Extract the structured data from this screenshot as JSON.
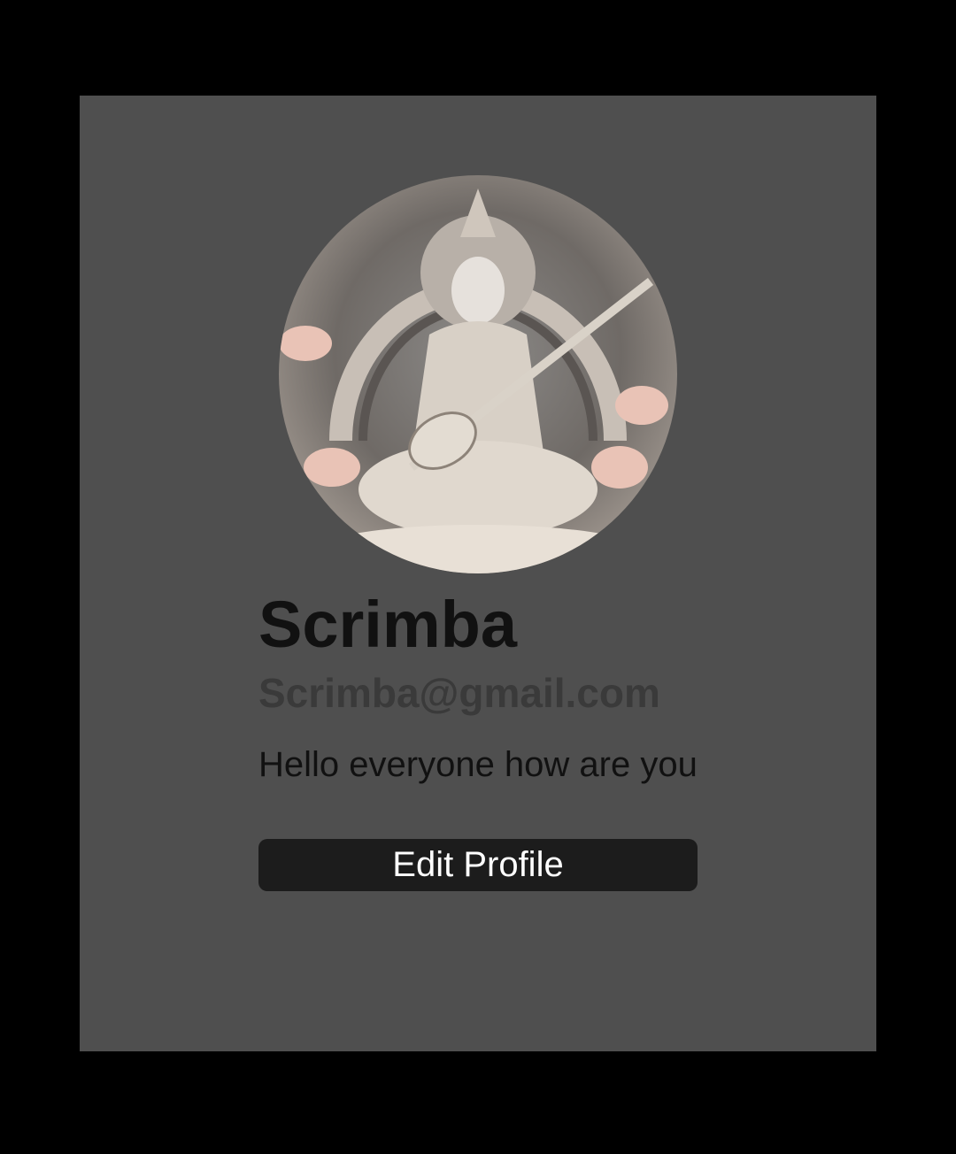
{
  "profile": {
    "name": "Scrimba",
    "email": "Scrimba@gmail.com",
    "bio": "Hello everyone how are you",
    "avatar_icon": "profile-avatar-image"
  },
  "actions": {
    "edit_label": "Edit Profile"
  },
  "colors": {
    "page_background": "#000000",
    "card_background": "#4f4f4f",
    "button_background": "#1c1c1c",
    "button_text": "#ffffff"
  }
}
